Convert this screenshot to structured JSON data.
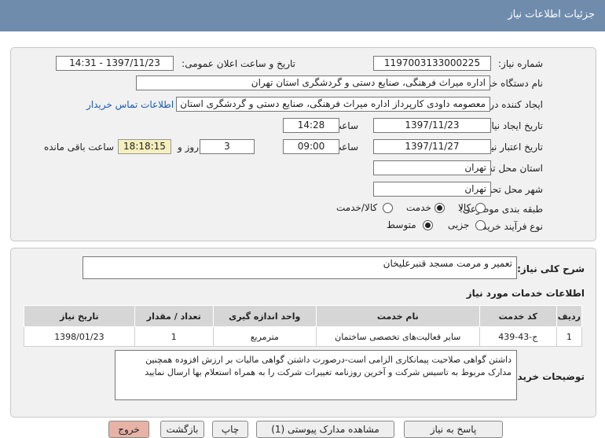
{
  "page_title": "جزئیات اطلاعات نیاز",
  "fields": {
    "need_number_label": "شماره نیاز:",
    "need_number": "1197003133000225",
    "announce_datetime_label": "تاریخ و ساعت اعلان عمومی:",
    "announce_datetime": "1397/11/23 - 14:31",
    "buyer_org_label": "نام دستگاه خریدار:",
    "buyer_org": "اداره میراث فرهنگی، صنایع دستی و گردشگری استان تهران",
    "requester_label": "ایجاد کننده درخواست:",
    "requester": "معصومه داودی کارپرداز اداره میراث فرهنگی، صنایع دستی و گردشگری استان تهران",
    "buyer_contact_link": "اطلاعات تماس خریدار",
    "created_date_label": "تاریخ ایجاد نیاز:",
    "created_date": "1397/11/23",
    "created_time_label": "ساعت",
    "created_time": "14:28",
    "validity_date_label": "تاریخ اعتبار نیاز:",
    "validity_date": "1397/11/27",
    "validity_time_label": "ساعت",
    "validity_time": "09:00",
    "days": "3",
    "days_label": "روز و",
    "remaining_time": "18:18:15",
    "remaining_label": "ساعت باقی مانده",
    "delivery_province_label": "استان محل تحویل:",
    "delivery_province": "تهران",
    "delivery_city_label": "شهر محل تحویل:",
    "delivery_city": "تهران",
    "category_label": "طبقه بندی موضوعی:",
    "category_options": [
      "کالا",
      "خدمت",
      "کالا/خدمت"
    ],
    "category_selected": "خدمت",
    "process_label": "نوع فرآیند خرید :",
    "process_options": [
      "جزیی",
      "متوسط"
    ],
    "process_selected": "متوسط"
  },
  "summary": {
    "label": "شرح کلی نیاز:",
    "value": "تعمیر و مرمت مسجد قنبرعلیخان"
  },
  "services": {
    "title": "اطلاعات خدمات مورد نیاز",
    "columns": [
      "ردیف",
      "کد خدمت",
      "نام خدمت",
      "واحد اندازه گیری",
      "تعداد / مقدار",
      "تاریخ نیاز"
    ],
    "rows": [
      [
        "1",
        "ج-43-439",
        "سایر فعالیت‌های تخصصی ساختمان",
        "مترمربع",
        "1",
        "1398/01/23"
      ]
    ]
  },
  "buyer_notes": {
    "label": "توضیحات خریدار:",
    "value": "داشتن گواهی صلاحیت پیمانکاری الزامی است-درصورت داشتن گواهی مالیات بر ارزش افزوده همچنین مدارک مربوط به تاسیس شرکت و آخرین روزنامه تغییرات شرکت را به همراه استعلام بها ارسال نمایید"
  },
  "buttons": {
    "reply": "پاسخ به نیاز",
    "view_documents": "مشاهده مدارک پیوستی (1)",
    "print": "چاپ",
    "back": "بازگشت",
    "exit": "خروج"
  }
}
